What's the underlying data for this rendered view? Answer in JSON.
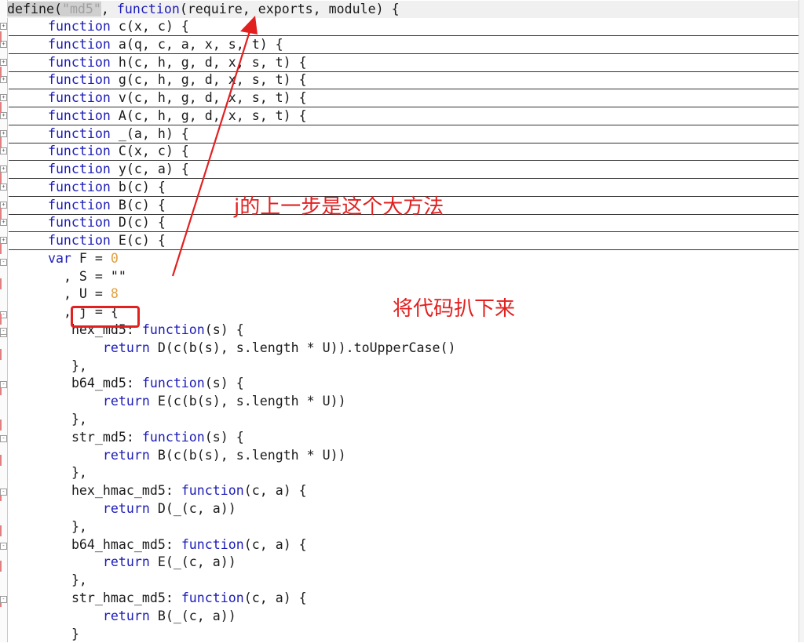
{
  "code": {
    "line1": {
      "kw1": "define",
      "p1": "(",
      "str": "\"md5\"",
      "comma": ", ",
      "kw2": "function",
      "rest": "(require, exports, module) {"
    },
    "collapsed_functions": [
      {
        "kw": "function",
        "sig": " c(x, c) {"
      },
      {
        "kw": "function",
        "sig": " a(q, c, a, x, s, t) {"
      },
      {
        "kw": "function",
        "sig": " h(c, h, g, d, x, s, t) {"
      },
      {
        "kw": "function",
        "sig": " g(c, h, g, d, x, s, t) {"
      },
      {
        "kw": "function",
        "sig": " v(c, h, g, d, x, s, t) {"
      },
      {
        "kw": "function",
        "sig": " A(c, h, g, d, x, s, t) {"
      },
      {
        "kw": "function",
        "sig": " _(a, h) {"
      },
      {
        "kw": "function",
        "sig": " C(x, c) {"
      },
      {
        "kw": "function",
        "sig": " y(c, a) {"
      },
      {
        "kw": "function",
        "sig": " b(c) {"
      },
      {
        "kw": "function",
        "sig": " B(c) {"
      },
      {
        "kw": "function",
        "sig": " D(c) {"
      },
      {
        "kw": "function",
        "sig": " E(c) {"
      }
    ],
    "var_line": {
      "kw": "var",
      "rest": " F = ",
      "num": "0"
    },
    "s_line": ", S = \"\"",
    "u_line": {
      "rest": ", U = ",
      "num": "8"
    },
    "j_line": ", j = {",
    "methods": [
      {
        "name": "hex_md5: ",
        "kw": "function",
        "params": "(s) {",
        "ret_kw": "return",
        "body": " D(c(b(s), s.length * U)).toUpperCase()",
        "close": "},"
      },
      {
        "name": "b64_md5: ",
        "kw": "function",
        "params": "(s) {",
        "ret_kw": "return",
        "body": " E(c(b(s), s.length * U))",
        "close": "},"
      },
      {
        "name": "str_md5: ",
        "kw": "function",
        "params": "(s) {",
        "ret_kw": "return",
        "body": " B(c(b(s), s.length * U))",
        "close": "},"
      },
      {
        "name": "hex_hmac_md5: ",
        "kw": "function",
        "params": "(c, a) {",
        "ret_kw": "return",
        "body": " D(_(c, a))",
        "close": "},"
      },
      {
        "name": "b64_hmac_md5: ",
        "kw": "function",
        "params": "(c, a) {",
        "ret_kw": "return",
        "body": " E(_(c, a))",
        "close": "},"
      },
      {
        "name": "str_hmac_md5: ",
        "kw": "function",
        "params": "(c, a) {",
        "ret_kw": "return",
        "body": " B(_(c, a))",
        "close": "}"
      }
    ]
  },
  "annotations": {
    "note_top": "j的上一步是这个大方法",
    "note_bottom": "将代码扒下来"
  },
  "colors": {
    "keyword": "#1c1cb8",
    "string": "#a0a0a0",
    "number": "#e0a040",
    "annotation": "#e32020"
  }
}
